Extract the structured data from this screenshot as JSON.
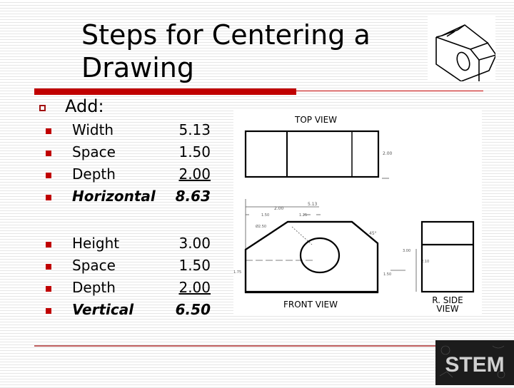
{
  "slide": {
    "title": "Steps for Centering a Drawing",
    "add_label": "Add:",
    "horizontal_items": [
      {
        "label": "Width",
        "value": "5.13",
        "underline": false,
        "total": false
      },
      {
        "label": "Space",
        "value": "1.50",
        "underline": false,
        "total": false
      },
      {
        "label": "Depth",
        "value": "2.00",
        "underline": true,
        "total": false
      },
      {
        "label": "Horizontal",
        "value": "8.63",
        "underline": false,
        "total": true
      }
    ],
    "vertical_items": [
      {
        "label": "Height",
        "value": "3.00",
        "underline": false,
        "total": false
      },
      {
        "label": "Space",
        "value": "1.50",
        "underline": false,
        "total": false
      },
      {
        "label": "Depth",
        "value": "2.00",
        "underline": true,
        "total": false
      },
      {
        "label": "Vertical",
        "value": "6.50",
        "underline": false,
        "total": true
      }
    ]
  },
  "drawing": {
    "top_view_label": "TOP VIEW",
    "front_view_label": "FRONT VIEW",
    "side_view_label_line1": "R. SIDE",
    "side_view_label_line2": "VIEW",
    "dims": {
      "top_depth": "2.00",
      "overall_width": "5.13",
      "upper_width": "2.00",
      "seg_a": "1.50",
      "seg_b": "1.25",
      "hole": "Ø2.50",
      "chamfer_angle": "45°",
      "hole_center_height": "1.75",
      "right_height": "2.10",
      "total_height": "3.00",
      "side_low": "1.50"
    }
  },
  "logo": {
    "text": "STEM"
  }
}
